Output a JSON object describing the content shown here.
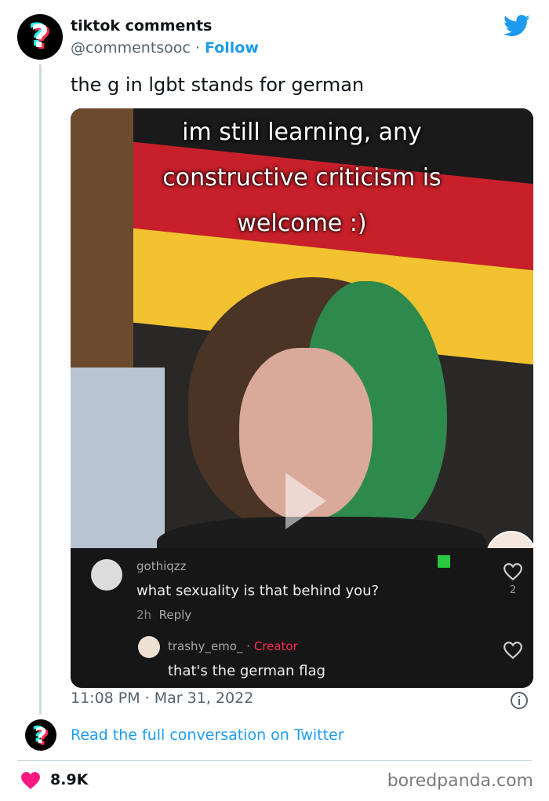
{
  "author": {
    "display_name": "tiktok comments",
    "handle": "@commentsooc",
    "separator": "·",
    "follow_label": "Follow",
    "avatar_icon": "question-mark-icon"
  },
  "tweet": {
    "text": "the g in lgbt stands for german",
    "timestamp": "11:08 PM · Mar 31, 2022",
    "like_count": "8.9K"
  },
  "media": {
    "caption_lines": [
      "im still learning, any",
      "constructive criticism is",
      "welcome :)"
    ],
    "comments": [
      {
        "username": "gothiqzz",
        "text": "what sexuality is that behind you?",
        "time": "2h",
        "reply_label": "Reply",
        "likes": "2"
      },
      {
        "username": "trashy_emo_",
        "separator": "·",
        "badge": "Creator",
        "text": "that's the german flag"
      }
    ]
  },
  "footer": {
    "read_more": "Read the full conversation on Twitter",
    "watermark": "boredpanda.com"
  },
  "colors": {
    "twitter_blue": "#1d9bf0",
    "like_red": "#f91880",
    "creator_red": "#fe2c55",
    "flag_black": "#1a1a1a",
    "flag_red": "#c8202a",
    "flag_gold": "#f2c230"
  }
}
